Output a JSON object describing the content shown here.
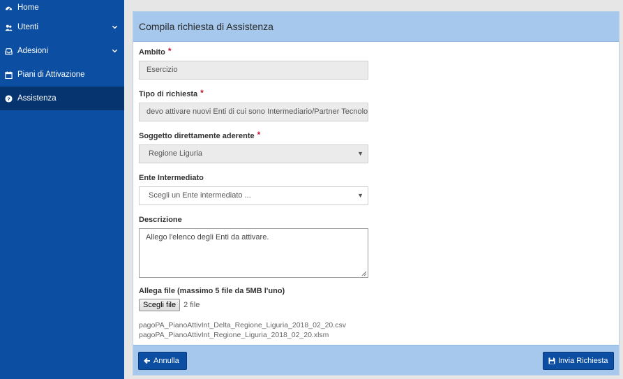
{
  "sidebar": {
    "items": [
      {
        "label": "Home",
        "icon": "dashboard-icon"
      },
      {
        "label": "Utenti",
        "icon": "users-icon",
        "has_submenu": true
      },
      {
        "label": "Adesioni",
        "icon": "inbox-icon",
        "has_submenu": true
      },
      {
        "label": "Piani di Attivazione",
        "icon": "calendar-icon"
      },
      {
        "label": "Assistenza",
        "icon": "question-circle-icon",
        "active": true
      }
    ]
  },
  "form": {
    "title": "Compila richiesta di Assistenza",
    "ambito": {
      "label": "Ambito",
      "value": "Esercizio",
      "required_mark": "*"
    },
    "tipo_richiesta": {
      "label": "Tipo di richiesta",
      "value": "devo attivare nuovi Enti di cui sono Intermediario/Partner Tecnologico",
      "required_mark": "*"
    },
    "soggetto": {
      "label": "Soggetto direttamente aderente",
      "value": "Regione Liguria",
      "required_mark": "*"
    },
    "ente": {
      "label": "Ente Intermediato",
      "value": "Scegli un Ente intermediato ..."
    },
    "descrizione": {
      "label": "Descrizione",
      "value": "Allego l'elenco degli Enti da attivare."
    },
    "allegati": {
      "label": "Allega file (massimo 5 file da 5MB l'uno)",
      "button_label": "Scegli file",
      "count_text": "2 file",
      "files": [
        "pagoPA_PianoAttivInt_Delta_Regione_Liguria_2018_02_20.csv",
        "pagoPA_PianoAttivInt_Regione_Liguria_2018_02_20.xlsm"
      ]
    }
  },
  "footer": {
    "cancel_label": "Annulla",
    "submit_label": "Invia Richiesta"
  },
  "colors": {
    "sidebar_bg": "#0b4ea2",
    "sidebar_active": "#05346f",
    "panel_header": "#a5c8ec",
    "required": "#c0122d"
  }
}
